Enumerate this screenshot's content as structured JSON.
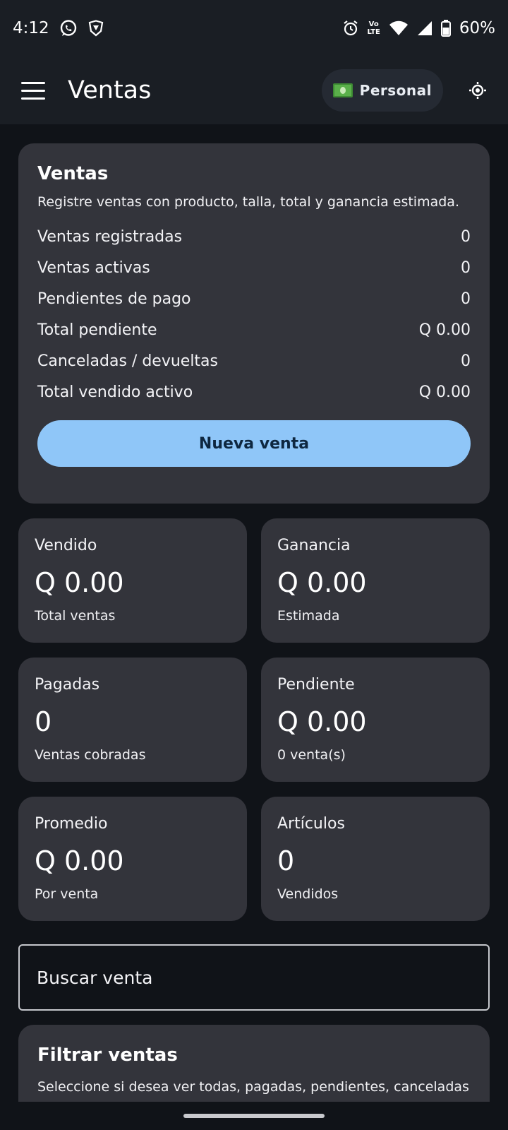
{
  "status_bar": {
    "time": "4:12",
    "battery": "60%",
    "icons_left": [
      "whatsapp-icon",
      "shield-icon"
    ],
    "icons_right": [
      "alarm-icon",
      "volte-icon",
      "wifi-icon",
      "signal-icon",
      "battery-icon"
    ],
    "volte_top": "Vo",
    "volte_bottom": "LTE"
  },
  "app_bar": {
    "title": "Ventas",
    "mode_chip": "Personal",
    "mode_icon": "money-icon"
  },
  "summary": {
    "title": "Ventas",
    "subtitle": "Registre ventas con producto, talla, total y ganancia estimada.",
    "rows": [
      {
        "label": "Ventas registradas",
        "value": "0"
      },
      {
        "label": "Ventas activas",
        "value": "0"
      },
      {
        "label": "Pendientes de pago",
        "value": "0"
      },
      {
        "label": "Total pendiente",
        "value": "Q 0.00"
      },
      {
        "label": "Canceladas / devueltas",
        "value": "0"
      },
      {
        "label": "Total vendido activo",
        "value": "Q 0.00"
      }
    ],
    "button": "Nueva venta"
  },
  "metrics": [
    {
      "label": "Vendido",
      "value": "Q 0.00",
      "caption": "Total ventas"
    },
    {
      "label": "Ganancia",
      "value": "Q 0.00",
      "caption": "Estimada"
    },
    {
      "label": "Pagadas",
      "value": "0",
      "caption": "Ventas cobradas"
    },
    {
      "label": "Pendiente",
      "value": "Q 0.00",
      "caption": "0 venta(s)"
    },
    {
      "label": "Promedio",
      "value": "Q 0.00",
      "caption": "Por venta"
    },
    {
      "label": "Artículos",
      "value": "0",
      "caption": "Vendidos"
    }
  ],
  "search": {
    "placeholder": "Buscar venta",
    "value": ""
  },
  "filter": {
    "title": "Filtrar ventas",
    "subtitle": "Seleccione si desea ver todas, pagadas, pendientes, canceladas o devueltas."
  },
  "colors": {
    "background": "#101318",
    "app_bar": "#1a1e24",
    "card": "#33343b",
    "accent_button": "#8fc6f8"
  }
}
